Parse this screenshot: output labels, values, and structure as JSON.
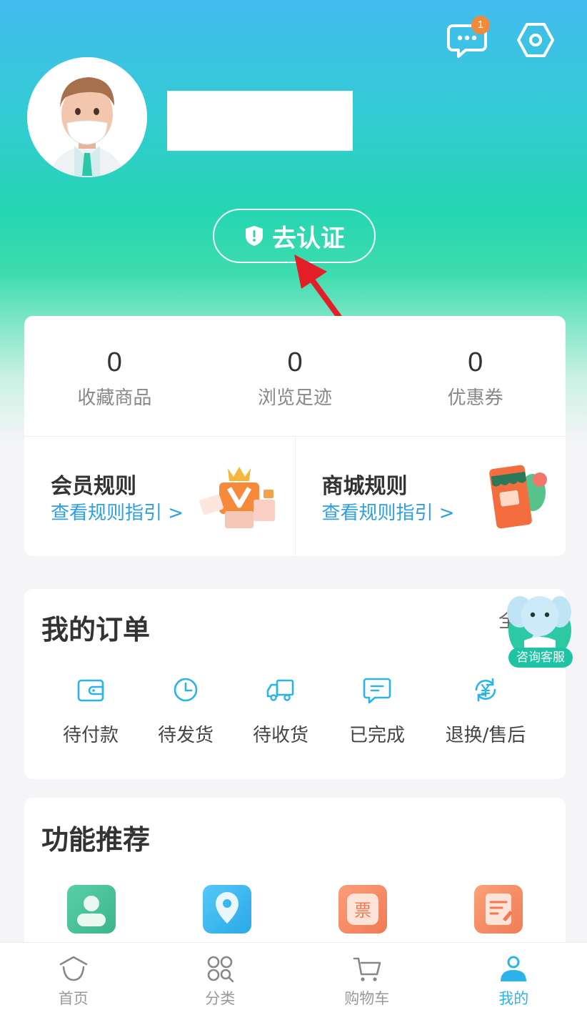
{
  "header": {
    "message_badge": "1",
    "message_icon": "chat-bubble-icon",
    "settings_icon": "hexagon-gear-icon"
  },
  "profile": {
    "avatar_icon": "doctor-avatar",
    "verify_label": "去认证",
    "verify_icon": "shield-alert-icon"
  },
  "stats": [
    {
      "value": "0",
      "label": "收藏商品"
    },
    {
      "value": "0",
      "label": "浏览足迹"
    },
    {
      "value": "0",
      "label": "优惠券"
    }
  ],
  "rules": [
    {
      "title": "会员规则",
      "link": "查看规则指引 >",
      "icon": "vip-gift-illustration"
    },
    {
      "title": "商城规则",
      "link": "查看规则指引 >",
      "icon": "shop-phone-illustration"
    }
  ],
  "orders": {
    "title": "我的订单",
    "all_label": "全",
    "items": [
      {
        "label": "待付款",
        "icon": "wallet-icon"
      },
      {
        "label": "待发货",
        "icon": "clock-icon"
      },
      {
        "label": "待收货",
        "icon": "truck-icon"
      },
      {
        "label": "已完成",
        "icon": "message-check-icon"
      },
      {
        "label": "退换/售后",
        "icon": "yen-refresh-icon"
      }
    ]
  },
  "service": {
    "label": "咨询客服",
    "icon": "elephant-mascot-icon"
  },
  "features": {
    "title": "功能推荐",
    "items": [
      {
        "icon": "user-card-icon",
        "color": "#4cc39a"
      },
      {
        "icon": "location-pin-icon",
        "color": "#39b8ef"
      },
      {
        "icon": "ticket-icon",
        "color": "#f7906b"
      },
      {
        "icon": "edit-doc-icon",
        "color": "#f5906c"
      }
    ],
    "ticket_glyph": "票"
  },
  "tabbar": [
    {
      "label": "首页",
      "icon": "home-icon",
      "active": false
    },
    {
      "label": "分类",
      "icon": "category-icon",
      "active": false
    },
    {
      "label": "购物车",
      "icon": "cart-icon",
      "active": false
    },
    {
      "label": "我的",
      "icon": "profile-icon",
      "active": true
    }
  ],
  "colors": {
    "accent": "#2ab4ea",
    "link": "#2e9fe0",
    "badge": "#f08a3c",
    "arrow": "#e41e26"
  }
}
